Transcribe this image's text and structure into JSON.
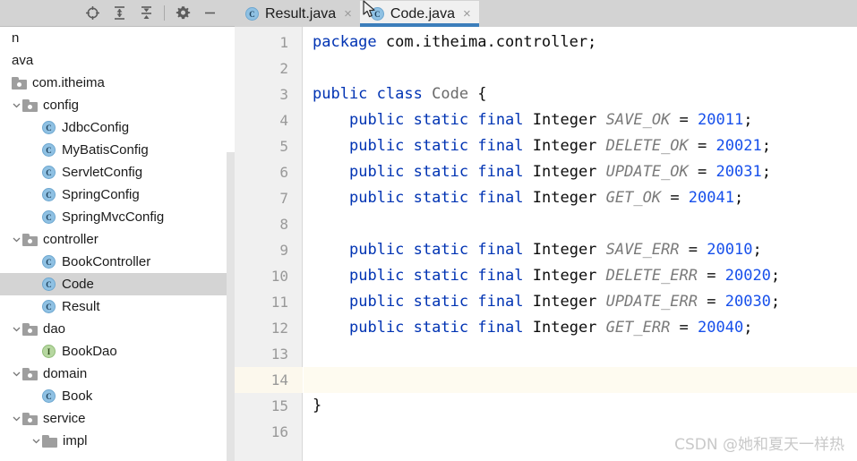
{
  "toolbar": {
    "buttons": [
      {
        "name": "locate-icon",
        "title": "Select Opened File"
      },
      {
        "name": "expand-all-icon",
        "title": "Expand All"
      },
      {
        "name": "collapse-all-icon",
        "title": "Collapse All"
      },
      {
        "name": "settings-gear-icon",
        "title": "Settings"
      },
      {
        "name": "minimize-icon",
        "title": "Hide"
      }
    ]
  },
  "tabs": [
    {
      "label": "Result.java",
      "icon": "java-class-icon",
      "icon_letter": "C",
      "active": false,
      "close": "×"
    },
    {
      "label": "Code.java",
      "icon": "java-class-icon",
      "icon_letter": "C",
      "active": true,
      "close": "×"
    }
  ],
  "tree": {
    "items": [
      {
        "label": "n",
        "indent": 0,
        "type": "truncated",
        "arrow": "none",
        "selected": false
      },
      {
        "label": "ava",
        "indent": 0,
        "type": "truncated",
        "arrow": "none",
        "selected": false
      },
      {
        "label": "com.itheima",
        "indent": 0,
        "type": "package",
        "arrow": "none",
        "selected": false
      },
      {
        "label": "config",
        "indent": 1,
        "type": "package",
        "arrow": "expanded",
        "selected": false
      },
      {
        "label": "JdbcConfig",
        "indent": 2,
        "type": "class",
        "arrow": "none",
        "selected": false,
        "icon_letter": "C"
      },
      {
        "label": "MyBatisConfig",
        "indent": 2,
        "type": "class",
        "arrow": "none",
        "selected": false,
        "icon_letter": "C"
      },
      {
        "label": "ServletConfig",
        "indent": 2,
        "type": "class",
        "arrow": "none",
        "selected": false,
        "icon_letter": "C"
      },
      {
        "label": "SpringConfig",
        "indent": 2,
        "type": "class",
        "arrow": "none",
        "selected": false,
        "icon_letter": "C"
      },
      {
        "label": "SpringMvcConfig",
        "indent": 2,
        "type": "class",
        "arrow": "none",
        "selected": false,
        "icon_letter": "C"
      },
      {
        "label": "controller",
        "indent": 1,
        "type": "package",
        "arrow": "expanded",
        "selected": false
      },
      {
        "label": "BookController",
        "indent": 2,
        "type": "class",
        "arrow": "none",
        "selected": false,
        "icon_letter": "C"
      },
      {
        "label": "Code",
        "indent": 2,
        "type": "class",
        "arrow": "none",
        "selected": true,
        "icon_letter": "C"
      },
      {
        "label": "Result",
        "indent": 2,
        "type": "class",
        "arrow": "none",
        "selected": false,
        "icon_letter": "C"
      },
      {
        "label": "dao",
        "indent": 1,
        "type": "package",
        "arrow": "expanded",
        "selected": false
      },
      {
        "label": "BookDao",
        "indent": 2,
        "type": "interface",
        "arrow": "none",
        "selected": false,
        "icon_letter": "I"
      },
      {
        "label": "domain",
        "indent": 1,
        "type": "package",
        "arrow": "expanded",
        "selected": false
      },
      {
        "label": "Book",
        "indent": 2,
        "type": "class",
        "arrow": "none",
        "selected": false,
        "icon_letter": "C"
      },
      {
        "label": "service",
        "indent": 1,
        "type": "package",
        "arrow": "expanded",
        "selected": false
      },
      {
        "label": "impl",
        "indent": 2,
        "type": "folder",
        "arrow": "expanded",
        "selected": false
      }
    ]
  },
  "editor": {
    "caret_line": 14,
    "lines": [
      {
        "n": "1",
        "tokens": [
          {
            "t": "package",
            "c": "kw"
          },
          {
            "t": " com.itheima.controller;",
            "c": "op"
          }
        ],
        "indent": 0
      },
      {
        "n": "2",
        "tokens": [],
        "indent": 0
      },
      {
        "n": "3",
        "tokens": [
          {
            "t": "public",
            "c": "kw"
          },
          {
            "t": " ",
            "c": "op"
          },
          {
            "t": "class",
            "c": "kw"
          },
          {
            "t": " ",
            "c": "op"
          },
          {
            "t": "Code",
            "c": "cls"
          },
          {
            "t": " {",
            "c": "op"
          }
        ],
        "indent": 0
      },
      {
        "n": "4",
        "tokens": [
          {
            "t": "public",
            "c": "kw"
          },
          {
            "t": " ",
            "c": "op"
          },
          {
            "t": "static",
            "c": "kw"
          },
          {
            "t": " ",
            "c": "op"
          },
          {
            "t": "final",
            "c": "kw"
          },
          {
            "t": " Integer ",
            "c": "op"
          },
          {
            "t": "SAVE_OK",
            "c": "const"
          },
          {
            "t": " = ",
            "c": "op"
          },
          {
            "t": "20011",
            "c": "num"
          },
          {
            "t": ";",
            "c": "op"
          }
        ],
        "indent": 1
      },
      {
        "n": "5",
        "tokens": [
          {
            "t": "public",
            "c": "kw"
          },
          {
            "t": " ",
            "c": "op"
          },
          {
            "t": "static",
            "c": "kw"
          },
          {
            "t": " ",
            "c": "op"
          },
          {
            "t": "final",
            "c": "kw"
          },
          {
            "t": " Integer ",
            "c": "op"
          },
          {
            "t": "DELETE_OK",
            "c": "const"
          },
          {
            "t": " = ",
            "c": "op"
          },
          {
            "t": "20021",
            "c": "num"
          },
          {
            "t": ";",
            "c": "op"
          }
        ],
        "indent": 1
      },
      {
        "n": "6",
        "tokens": [
          {
            "t": "public",
            "c": "kw"
          },
          {
            "t": " ",
            "c": "op"
          },
          {
            "t": "static",
            "c": "kw"
          },
          {
            "t": " ",
            "c": "op"
          },
          {
            "t": "final",
            "c": "kw"
          },
          {
            "t": " Integer ",
            "c": "op"
          },
          {
            "t": "UPDATE_OK",
            "c": "const"
          },
          {
            "t": " = ",
            "c": "op"
          },
          {
            "t": "20031",
            "c": "num"
          },
          {
            "t": ";",
            "c": "op"
          }
        ],
        "indent": 1
      },
      {
        "n": "7",
        "tokens": [
          {
            "t": "public",
            "c": "kw"
          },
          {
            "t": " ",
            "c": "op"
          },
          {
            "t": "static",
            "c": "kw"
          },
          {
            "t": " ",
            "c": "op"
          },
          {
            "t": "final",
            "c": "kw"
          },
          {
            "t": " Integer ",
            "c": "op"
          },
          {
            "t": "GET_OK",
            "c": "const"
          },
          {
            "t": " = ",
            "c": "op"
          },
          {
            "t": "20041",
            "c": "num"
          },
          {
            "t": ";",
            "c": "op"
          }
        ],
        "indent": 1
      },
      {
        "n": "8",
        "tokens": [],
        "indent": 0
      },
      {
        "n": "9",
        "tokens": [
          {
            "t": "public",
            "c": "kw"
          },
          {
            "t": " ",
            "c": "op"
          },
          {
            "t": "static",
            "c": "kw"
          },
          {
            "t": " ",
            "c": "op"
          },
          {
            "t": "final",
            "c": "kw"
          },
          {
            "t": " Integer ",
            "c": "op"
          },
          {
            "t": "SAVE_ERR",
            "c": "const"
          },
          {
            "t": " = ",
            "c": "op"
          },
          {
            "t": "20010",
            "c": "num"
          },
          {
            "t": ";",
            "c": "op"
          }
        ],
        "indent": 1
      },
      {
        "n": "10",
        "tokens": [
          {
            "t": "public",
            "c": "kw"
          },
          {
            "t": " ",
            "c": "op"
          },
          {
            "t": "static",
            "c": "kw"
          },
          {
            "t": " ",
            "c": "op"
          },
          {
            "t": "final",
            "c": "kw"
          },
          {
            "t": " Integer ",
            "c": "op"
          },
          {
            "t": "DELETE_ERR",
            "c": "const"
          },
          {
            "t": " = ",
            "c": "op"
          },
          {
            "t": "20020",
            "c": "num"
          },
          {
            "t": ";",
            "c": "op"
          }
        ],
        "indent": 1
      },
      {
        "n": "11",
        "tokens": [
          {
            "t": "public",
            "c": "kw"
          },
          {
            "t": " ",
            "c": "op"
          },
          {
            "t": "static",
            "c": "kw"
          },
          {
            "t": " ",
            "c": "op"
          },
          {
            "t": "final",
            "c": "kw"
          },
          {
            "t": " Integer ",
            "c": "op"
          },
          {
            "t": "UPDATE_ERR",
            "c": "const"
          },
          {
            "t": " = ",
            "c": "op"
          },
          {
            "t": "20030",
            "c": "num"
          },
          {
            "t": ";",
            "c": "op"
          }
        ],
        "indent": 1
      },
      {
        "n": "12",
        "tokens": [
          {
            "t": "public",
            "c": "kw"
          },
          {
            "t": " ",
            "c": "op"
          },
          {
            "t": "static",
            "c": "kw"
          },
          {
            "t": " ",
            "c": "op"
          },
          {
            "t": "final",
            "c": "kw"
          },
          {
            "t": " Integer ",
            "c": "op"
          },
          {
            "t": "GET_ERR",
            "c": "const"
          },
          {
            "t": " = ",
            "c": "op"
          },
          {
            "t": "20040",
            "c": "num"
          },
          {
            "t": ";",
            "c": "op"
          }
        ],
        "indent": 1
      },
      {
        "n": "13",
        "tokens": [],
        "indent": 0
      },
      {
        "n": "14",
        "tokens": [],
        "indent": 0
      },
      {
        "n": "15",
        "tokens": [
          {
            "t": "}",
            "c": "op"
          }
        ],
        "indent": 0
      },
      {
        "n": "16",
        "tokens": [],
        "indent": 0
      }
    ]
  },
  "watermark": {
    "text": "CSDN @她和夏天一样热"
  },
  "colors": {
    "keyword": "#0033b3",
    "number": "#1750eb",
    "constant": "#7a7a7a",
    "classname": "#6a6a6a",
    "tab_active_underline": "#3c7ebb",
    "tree_selection": "#d4d4d4",
    "caret_line": "#fefbf0",
    "header_bg": "#d3d3d3",
    "gutter_bg": "#f0f0f0"
  }
}
